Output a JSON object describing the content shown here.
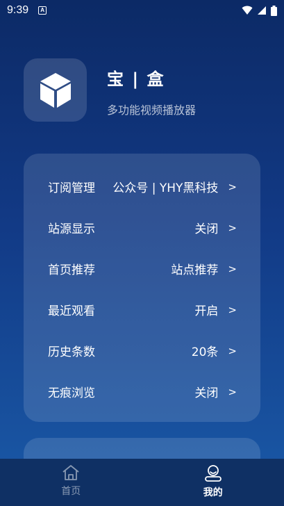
{
  "status_bar": {
    "time": "9:39",
    "notification_icon": "a-box-icon",
    "icons": [
      "wifi-icon",
      "signal-icon",
      "battery-icon"
    ]
  },
  "app": {
    "icon": "cube-icon",
    "title": "宝 | 盒",
    "subtitle": "多功能视频播放器"
  },
  "settings": [
    {
      "label": "订阅管理",
      "value": "公众号 | YHY黑科技",
      "arrow": ">"
    },
    {
      "label": "站源显示",
      "value": "关闭",
      "arrow": ">"
    },
    {
      "label": "首页推荐",
      "value": "站点推荐",
      "arrow": ">"
    },
    {
      "label": "最近观看",
      "value": "开启",
      "arrow": ">"
    },
    {
      "label": "历史条数",
      "value": "20条",
      "arrow": ">"
    },
    {
      "label": "无痕浏览",
      "value": "关闭",
      "arrow": ">"
    }
  ],
  "bottom_nav": [
    {
      "label": "首页",
      "icon": "home-icon",
      "active": false
    },
    {
      "label": "我的",
      "icon": "profile-icon",
      "active": true
    }
  ],
  "colors": {
    "background_top": "#0c2a66",
    "background_bottom": "#1a5aa8",
    "nav_background": "#0f3064"
  }
}
